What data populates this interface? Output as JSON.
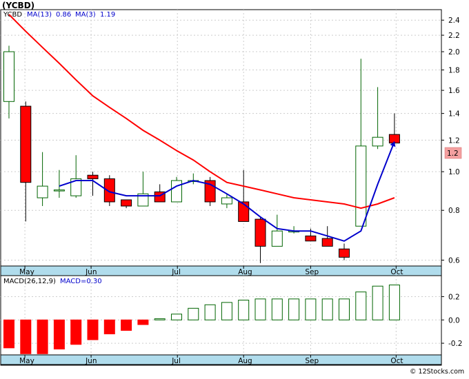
{
  "title": "(YCBD)",
  "legend": {
    "symbol": "YCBD",
    "ma13_label": "MA(13)",
    "ma13_value": "0.86",
    "ma3_label": "MA(3)",
    "ma3_value": "1.19"
  },
  "macd_legend": {
    "label": "MACD(26,12,9)",
    "value_label": "MACD=0.30"
  },
  "last_price_label": "1.2",
  "footer": "© 12Stocks.com",
  "colors": {
    "up_candle": "#ffffff",
    "up_outline": "#006400",
    "down_candle": "#ff0000",
    "ma13": "#ff0000",
    "ma3": "#0000cc",
    "axis_band": "#b0dcec",
    "grid": "#cccccc"
  },
  "chart_data": [
    {
      "type": "candlestick",
      "title": "(YCBD)",
      "scale": "log",
      "ylim": [
        0.58,
        2.55
      ],
      "y_ticks": [
        "2.4",
        "2.2",
        "2.0",
        "1.8",
        "1.6",
        "1.4",
        "1.2",
        "1.0",
        "0.8",
        "0.6"
      ],
      "y_tick_values": [
        2.4,
        2.2,
        2.0,
        1.8,
        1.6,
        1.4,
        1.2,
        1.0,
        0.8,
        0.6
      ],
      "x_labels": [
        "May",
        "Jun",
        "Jul",
        "Aug",
        "Sep",
        "Oct"
      ],
      "candles": [
        {
          "open": 1.5,
          "close": 2.0,
          "high": 2.07,
          "low": 1.36
        },
        {
          "open": 1.46,
          "close": 0.94,
          "high": 1.5,
          "low": 0.75
        },
        {
          "open": 0.86,
          "close": 0.92,
          "high": 1.12,
          "low": 0.82
        },
        {
          "open": 0.9,
          "close": 0.9,
          "high": 1.01,
          "low": 0.86
        },
        {
          "open": 0.87,
          "close": 0.96,
          "high": 1.1,
          "low": 0.86
        },
        {
          "open": 0.98,
          "close": 0.96,
          "high": 1.0,
          "low": 0.87
        },
        {
          "open": 0.96,
          "close": 0.84,
          "high": 0.98,
          "low": 0.82
        },
        {
          "open": 0.85,
          "close": 0.82,
          "high": 0.85,
          "low": 0.81
        },
        {
          "open": 0.82,
          "close": 0.88,
          "high": 1.0,
          "low": 0.82
        },
        {
          "open": 0.89,
          "close": 0.84,
          "high": 0.93,
          "low": 0.84
        },
        {
          "open": 0.84,
          "close": 0.95,
          "high": 0.97,
          "low": 0.84
        },
        {
          "open": 0.95,
          "close": 0.95,
          "high": 0.99,
          "low": 0.93
        },
        {
          "open": 0.95,
          "close": 0.84,
          "high": 0.97,
          "low": 0.82
        },
        {
          "open": 0.83,
          "close": 0.86,
          "high": 0.88,
          "low": 0.81
        },
        {
          "open": 0.84,
          "close": 0.75,
          "high": 1.01,
          "low": 0.75
        },
        {
          "open": 0.76,
          "close": 0.65,
          "high": 0.77,
          "low": 0.59
        },
        {
          "open": 0.65,
          "close": 0.71,
          "high": 0.78,
          "low": 0.65
        },
        {
          "open": 0.71,
          "close": 0.71,
          "high": 0.73,
          "low": 0.7
        },
        {
          "open": 0.69,
          "close": 0.67,
          "high": 0.72,
          "low": 0.67
        },
        {
          "open": 0.68,
          "close": 0.65,
          "high": 0.73,
          "low": 0.65
        },
        {
          "open": 0.64,
          "close": 0.61,
          "high": 0.66,
          "low": 0.6
        },
        {
          "open": 0.73,
          "close": 1.16,
          "high": 1.92,
          "low": 0.73
        },
        {
          "open": 1.16,
          "close": 1.22,
          "high": 1.63,
          "low": 1.14
        },
        {
          "open": 1.24,
          "close": 1.18,
          "high": 1.4,
          "low": 1.18
        }
      ],
      "series": [
        {
          "name": "MA(13)",
          "x": [
            0,
            1,
            2,
            3,
            4,
            5,
            6,
            7,
            8,
            9,
            10,
            11,
            12,
            13,
            14,
            15,
            16,
            17,
            18,
            19,
            20,
            21,
            22,
            23
          ],
          "values": [
            2.48,
            2.25,
            2.05,
            1.87,
            1.7,
            1.55,
            1.45,
            1.36,
            1.27,
            1.2,
            1.13,
            1.07,
            1.0,
            0.94,
            0.92,
            0.9,
            0.88,
            0.86,
            0.85,
            0.84,
            0.83,
            0.81,
            0.83,
            0.86
          ]
        },
        {
          "name": "MA(3)",
          "x": [
            3,
            4,
            5,
            6,
            7,
            8,
            9,
            10,
            11,
            12,
            13,
            14,
            15,
            16,
            17,
            18,
            19,
            20,
            21,
            22,
            23
          ],
          "values": [
            0.92,
            0.95,
            0.95,
            0.89,
            0.87,
            0.87,
            0.87,
            0.92,
            0.95,
            0.93,
            0.88,
            0.83,
            0.77,
            0.72,
            0.71,
            0.71,
            0.69,
            0.67,
            0.71,
            0.93,
            1.19
          ]
        }
      ]
    },
    {
      "type": "bar",
      "title": "MACD(26,12,9)",
      "ylim": [
        -0.3,
        0.38
      ],
      "y_ticks": [
        "0.2",
        "0.0",
        "-0.2"
      ],
      "y_tick_values": [
        0.2,
        0.0,
        -0.2
      ],
      "x_labels": [
        "May",
        "Jun",
        "Jul",
        "Aug",
        "Sep",
        "Oct"
      ],
      "values": [
        -0.24,
        -0.29,
        -0.29,
        -0.25,
        -0.21,
        -0.17,
        -0.12,
        -0.09,
        -0.04,
        0.01,
        0.05,
        0.1,
        0.13,
        0.15,
        0.17,
        0.18,
        0.18,
        0.18,
        0.18,
        0.18,
        0.18,
        0.24,
        0.29,
        0.3
      ]
    }
  ]
}
